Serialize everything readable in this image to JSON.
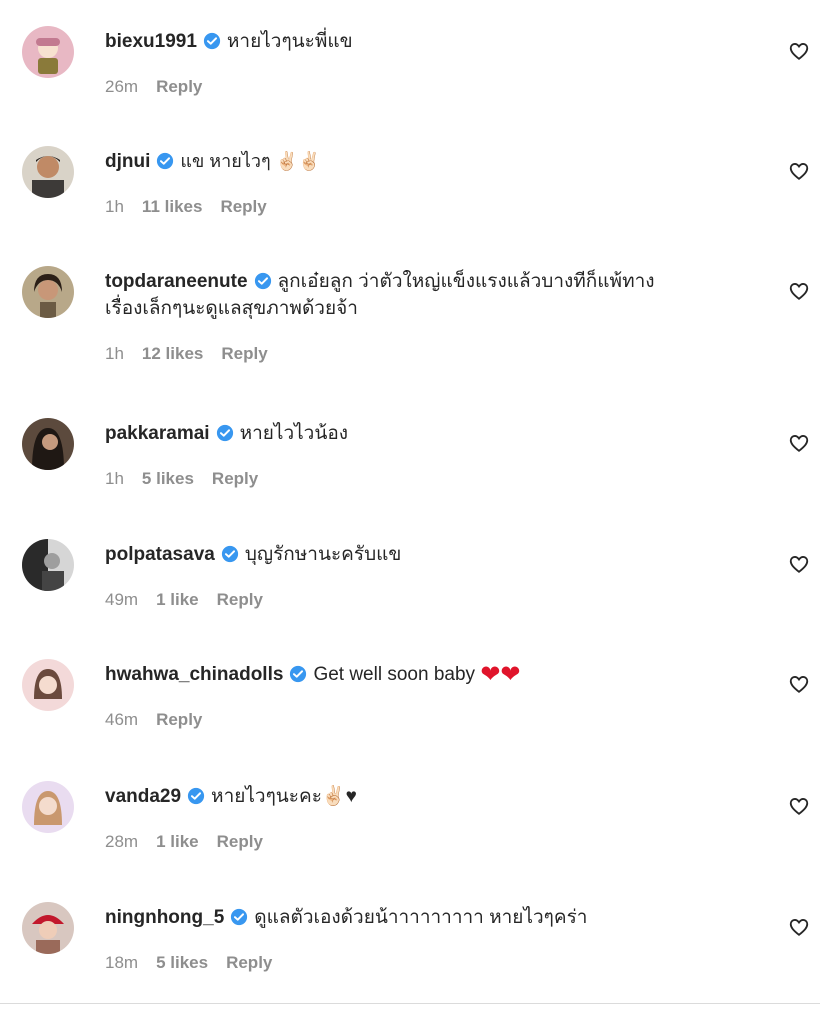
{
  "comments": [
    {
      "username": "biexu1991",
      "text": "หายไวๆนะพี่แข",
      "time": "26m",
      "likes": "",
      "reply": "Reply"
    },
    {
      "username": "djnui",
      "text": "แข หายไวๆ ✌🏻✌🏻",
      "time": "1h",
      "likes": "11 likes",
      "reply": "Reply"
    },
    {
      "username": "topdaraneenute",
      "text": "ลูกเอ๋ยลูก ว่าตัวใหญ่แข็งแรงแล้วบางทีก็แพ้ทาง",
      "text2": "เรื่องเล็กๆนะดูแลสุขภาพด้วยจ้า",
      "time": "1h",
      "likes": "12 likes",
      "reply": "Reply"
    },
    {
      "username": "pakkaramai",
      "text": "หายไวไวน้อง",
      "time": "1h",
      "likes": "5 likes",
      "reply": "Reply"
    },
    {
      "username": "polpatasava",
      "text": "บุญรักษานะครับแข",
      "time": "49m",
      "likes": "1 like",
      "reply": "Reply"
    },
    {
      "username": "hwahwa_chinadolls",
      "text": "Get well soon baby",
      "hearts": "❤❤",
      "time": "46m",
      "likes": "",
      "reply": "Reply"
    },
    {
      "username": "vanda29",
      "text": "หายไวๆนะคะ✌🏻♥",
      "time": "28m",
      "likes": "1 like",
      "reply": "Reply"
    },
    {
      "username": "ningnhong_5",
      "text": "ดูแลตัวเองด้วยน้าาาาาาาาา หายไวๆคร่า",
      "time": "18m",
      "likes": "5 likes",
      "reply": "Reply"
    }
  ],
  "icons": {
    "verified": "verified-badge-icon",
    "like": "heart-outline-icon"
  },
  "colors": {
    "verified": "#3897f0",
    "meta": "#8e8e8e",
    "text": "#262626",
    "red_heart": "#e0142b"
  }
}
